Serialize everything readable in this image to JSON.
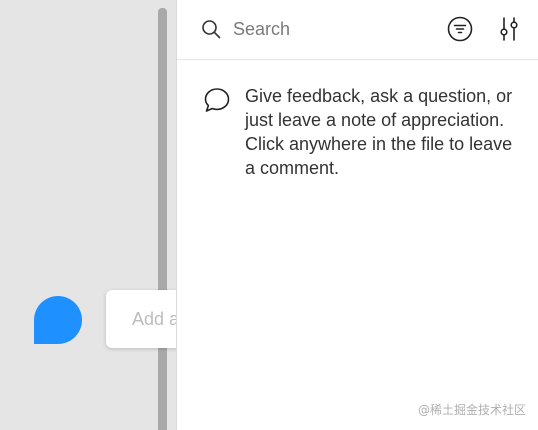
{
  "canvas": {
    "comment_input": {
      "placeholder": "Add a comment"
    }
  },
  "comments_panel": {
    "search": {
      "placeholder": "Search"
    },
    "icons": {
      "search": "search-icon",
      "filter": "filter-icon",
      "settings": "sliders-icon",
      "empty_state": "speech-bubble-icon"
    },
    "empty_state": {
      "message": "Give feedback, ask a question, or just leave a note of appreciation. Click anywhere in the file to leave a comment."
    }
  },
  "watermark": {
    "text": "@稀土掘金技术社区"
  },
  "colors": {
    "accent": "#1e90ff",
    "canvas_bg": "#e5e5e5",
    "panel_bg": "#ffffff"
  }
}
